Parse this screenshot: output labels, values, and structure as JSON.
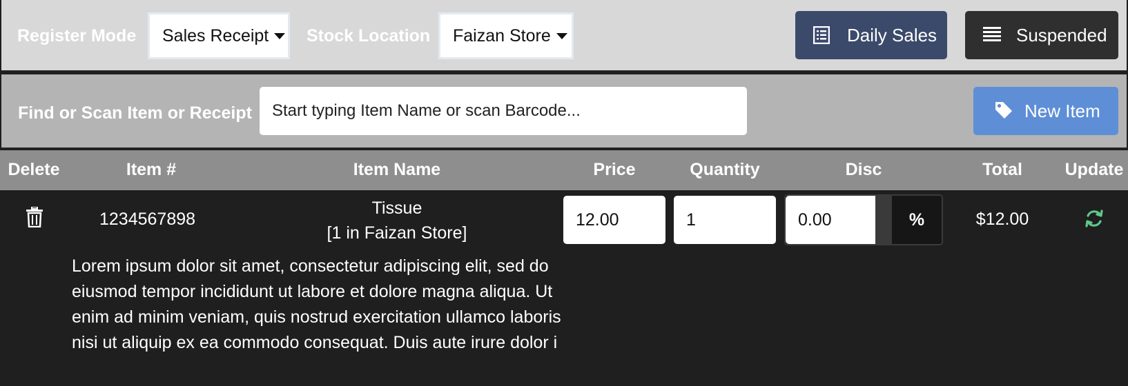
{
  "register": {
    "mode_label": "Register Mode",
    "mode_value": "Sales Receipt",
    "location_label": "Stock Location",
    "location_value": "Faizan Store",
    "daily_sales_label": "Daily Sales",
    "suspended_label": "Suspended"
  },
  "search": {
    "label": "Find or Scan Item or Receipt",
    "placeholder": "Start typing Item Name or scan Barcode...",
    "new_item_label": "New Item"
  },
  "table": {
    "headers": [
      "Delete",
      "Item #",
      "Item Name",
      "Price",
      "Quantity",
      "Disc",
      "Total",
      "Update"
    ],
    "rows": [
      {
        "item_number": "1234567898",
        "item_name": "Tissue",
        "stock_info": "[1 in Faizan Store]",
        "price": "12.00",
        "quantity": "1",
        "discount": "0.00",
        "discount_type": "%",
        "total": "$12.00",
        "description": "Lorem ipsum dolor sit amet, consectetur adipiscing elit, sed do eiusmod tempor incididunt ut labore et dolore magna aliqua. Ut enim ad minim veniam, quis nostrud exercitation ullamco laboris nisi ut aliquip ex ea commodo consequat. Duis aute irure dolor i"
      }
    ]
  },
  "colors": {
    "daily_sales_bg": "#3b4a6b",
    "suspended_bg": "#2f2f2f",
    "new_item_bg": "#5e8fd6",
    "update_icon": "#5cc98a"
  },
  "icons": {
    "daily_sales": "list-alt-icon",
    "suspended": "align-justify-icon",
    "new_item": "tag-icon",
    "delete": "trash-icon",
    "update": "refresh-icon"
  }
}
